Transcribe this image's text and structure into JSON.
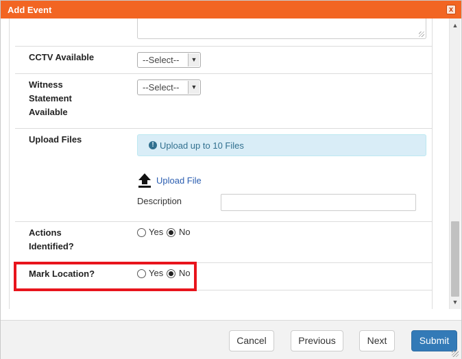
{
  "dialog": {
    "title": "Add Event",
    "close_glyph": "x"
  },
  "form": {
    "cctv": {
      "label": "CCTV Available",
      "selected": "--Select--"
    },
    "witness": {
      "label_line1": "Witness",
      "label_line2": "Statement",
      "label_line3": "Available",
      "selected": "--Select--"
    },
    "upload": {
      "label": "Upload Files",
      "info_text": "Upload up to 10 Files",
      "info_icon": "info-circle-icon",
      "link_text": "Upload File",
      "link_icon": "upload-arrow-icon",
      "description_label": "Description",
      "description_value": ""
    },
    "actions_identified": {
      "label_line1": "Actions",
      "label_line2": "Identified?",
      "yes_label": "Yes",
      "no_label": "No",
      "selected": "No"
    },
    "mark_location": {
      "label": "Mark Location?",
      "yes_label": "Yes",
      "no_label": "No",
      "selected": "No"
    }
  },
  "footer": {
    "cancel_label": "Cancel",
    "previous_label": "Previous",
    "next_label": "Next",
    "submit_label": "Submit"
  },
  "colors": {
    "titlebar": "#f26522",
    "primary_button": "#337ab7",
    "info_background": "#d9edf7",
    "highlight": "#e8141c"
  }
}
